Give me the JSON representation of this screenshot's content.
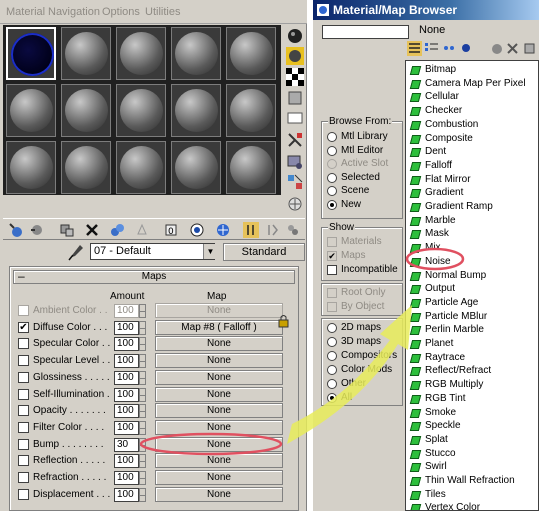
{
  "editor": {
    "menu": [
      "Material",
      "Navigation",
      "Options",
      "Utilities"
    ],
    "material_name": "07 - Default",
    "material_type": "Standard",
    "maps_title": "Maps",
    "col_amount": "Amount",
    "col_map": "Map",
    "rows": [
      {
        "label": "Ambient Color . .",
        "amount": "100",
        "map": "None",
        "checked": false,
        "dim": true
      },
      {
        "label": "Diffuse Color . . .",
        "amount": "100",
        "map": "Map #8  ( Falloff )",
        "checked": true,
        "dim": false
      },
      {
        "label": "Specular Color . .",
        "amount": "100",
        "map": "None",
        "checked": false,
        "dim": false
      },
      {
        "label": "Specular Level . .",
        "amount": "100",
        "map": "None",
        "checked": false,
        "dim": false
      },
      {
        "label": "Glossiness . . . . .",
        "amount": "100",
        "map": "None",
        "checked": false,
        "dim": false
      },
      {
        "label": "Self-Illumination .",
        "amount": "100",
        "map": "None",
        "checked": false,
        "dim": false
      },
      {
        "label": "Opacity . . . . . . .",
        "amount": "100",
        "map": "None",
        "checked": false,
        "dim": false
      },
      {
        "label": "Filter Color . . . .",
        "amount": "100",
        "map": "None",
        "checked": false,
        "dim": false
      },
      {
        "label": "Bump . . . . . . . .",
        "amount": "30",
        "map": "None",
        "checked": false,
        "dim": false
      },
      {
        "label": "Reflection . . . . .",
        "amount": "100",
        "map": "None",
        "checked": false,
        "dim": false
      },
      {
        "label": "Refraction . . . . .",
        "amount": "100",
        "map": "None",
        "checked": false,
        "dim": false
      },
      {
        "label": "Displacement . . .",
        "amount": "100",
        "map": "None",
        "checked": false,
        "dim": false
      }
    ]
  },
  "browser": {
    "title": "Material/Map Browser",
    "selected": "None",
    "browse_from": {
      "label": "Browse From:",
      "options": [
        {
          "label": "Mtl Library",
          "on": false,
          "dim": false
        },
        {
          "label": "Mtl Editor",
          "on": false,
          "dim": false
        },
        {
          "label": "Active Slot",
          "on": false,
          "dim": true
        },
        {
          "label": "Selected",
          "on": false,
          "dim": false
        },
        {
          "label": "Scene",
          "on": false,
          "dim": false
        },
        {
          "label": "New",
          "on": true,
          "dim": false
        }
      ]
    },
    "show": {
      "label": "Show",
      "options": [
        {
          "label": "Materials",
          "checked": false,
          "dim": true
        },
        {
          "label": "Maps",
          "checked": true,
          "dim": true
        },
        {
          "label": "Incompatible",
          "checked": false,
          "dim": false
        }
      ]
    },
    "root": [
      {
        "label": "Root Only",
        "dim": true
      },
      {
        "label": "By Object",
        "dim": true
      }
    ],
    "types": [
      {
        "label": "2D maps",
        "on": false,
        "dim": false
      },
      {
        "label": "3D maps",
        "on": false,
        "dim": false
      },
      {
        "label": "Compositors",
        "on": false,
        "dim": false
      },
      {
        "label": "Color Mods",
        "on": false,
        "dim": false
      },
      {
        "label": "Other",
        "on": false,
        "dim": false
      },
      {
        "label": "All",
        "on": true,
        "dim": false
      }
    ],
    "maps": [
      "Bitmap",
      "Camera Map Per Pixel",
      "Cellular",
      "Checker",
      "Combustion",
      "Composite",
      "Dent",
      "Falloff",
      "Flat Mirror",
      "Gradient",
      "Gradient Ramp",
      "Marble",
      "Mask",
      "Mix",
      "Noise",
      "Normal Bump",
      "Output",
      "Particle Age",
      "Particle MBlur",
      "Perlin Marble",
      "Planet",
      "Raytrace",
      "Reflect/Refract",
      "RGB Multiply",
      "RGB Tint",
      "Smoke",
      "Speckle",
      "Splat",
      "Stucco",
      "Swirl",
      "Thin Wall Refraction",
      "Tiles",
      "Vertex Color"
    ]
  },
  "colors": {
    "highlight_ring": "#e05060",
    "arrow": "#e8ec5a",
    "title_gradient_start": "#0a246a"
  }
}
